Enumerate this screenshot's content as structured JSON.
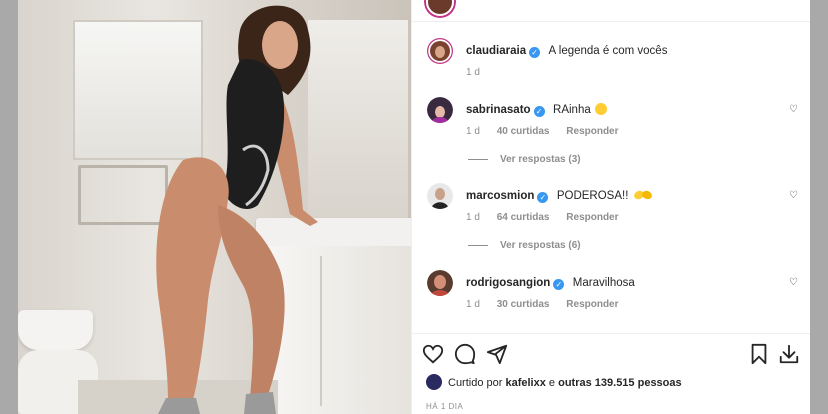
{
  "post": {
    "caption": {
      "username": "claudiaraia",
      "text": "A legenda é com vocês",
      "time": "1 d"
    },
    "comments": [
      {
        "username": "sabrinasato",
        "text": "RAinha",
        "emoji": "heart-eyes-emoji",
        "time": "1 d",
        "likes": "40 curtidas",
        "reply_label": "Responder",
        "view_replies": "Ver respostas (3)"
      },
      {
        "username": "marcosmion",
        "text": "PODEROSA!!",
        "emoji": "clapping-hands-emoji",
        "time": "1 d",
        "likes": "64 curtidas",
        "reply_label": "Responder",
        "view_replies": "Ver respostas (6)"
      },
      {
        "username": "rodrigosangion",
        "text": "Maravilhosa",
        "time": "1 d",
        "likes": "30 curtidas",
        "reply_label": "Responder"
      }
    ],
    "liked_by": {
      "prefix": "Curtido por",
      "user": "kafelixx",
      "middle": "e",
      "others": "outras 139.515 pessoas"
    },
    "posted_ago": "HÁ 1 DIA"
  },
  "icons": {
    "like": "heart-icon",
    "comment": "comment-icon",
    "share": "send-icon",
    "save": "bookmark-icon",
    "download": "download-icon",
    "verified": "verified-badge-icon"
  },
  "colors": {
    "verified": "#3897f0",
    "text": "#262626",
    "muted": "#8e8e8e"
  }
}
